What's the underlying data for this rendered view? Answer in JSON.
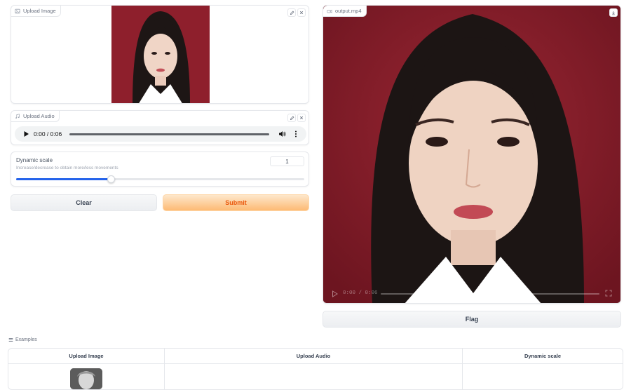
{
  "upload_image": {
    "label": "Upload Image",
    "edit_icon": "pencil-icon",
    "clear_icon": "close-icon"
  },
  "upload_audio": {
    "label": "Upload Audio",
    "time": "0:00 / 0:06",
    "progress": 0
  },
  "dynamic_scale": {
    "label": "Dynamic scale",
    "info": "Increase/decrease to obtain more/less movements",
    "value": "1",
    "slider_fraction": 0.33
  },
  "buttons": {
    "clear": "Clear",
    "submit": "Submit",
    "flag": "Flag"
  },
  "output": {
    "label": "output.mp4",
    "time": "0:00 / 0:06"
  },
  "examples": {
    "label": "Examples",
    "headers": [
      "Upload Image",
      "Upload Audio",
      "Dynamic scale"
    ]
  },
  "colors": {
    "accent": "#2563eb",
    "submit_gradient_start": "#fde7cc",
    "submit_gradient_end": "#fdba74",
    "submit_text": "#ea580c",
    "photo_background": "#8b1c2a"
  }
}
